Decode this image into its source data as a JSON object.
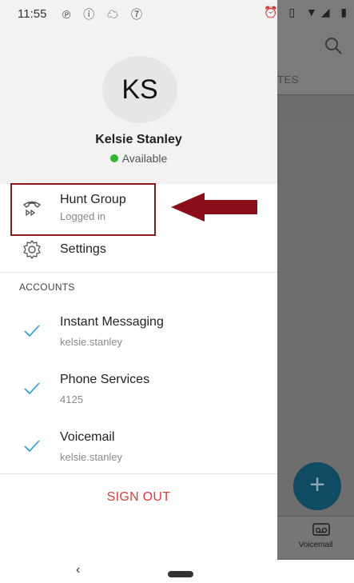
{
  "status_bar": {
    "time": "11:55",
    "left_icons": "℗ ⓘ ☁ ⑦",
    "right_icons": "⏰ ▯ ▼◢ ▮"
  },
  "background_app": {
    "tab_label": "TES",
    "bottom_nav_label": "Voicemail",
    "fab_symbol": "+"
  },
  "profile": {
    "initials": "KS",
    "name": "Kelsie Stanley",
    "presence": "Available",
    "presence_color": "#2fb82f"
  },
  "menu": {
    "hunt_group": {
      "label": "Hunt Group",
      "status": "Logged in"
    },
    "settings": {
      "label": "Settings"
    }
  },
  "accounts": {
    "title": "ACCOUNTS",
    "items": [
      {
        "name": "Instant Messaging",
        "detail": "kelsie.stanley"
      },
      {
        "name": "Phone Services",
        "detail": "4125"
      },
      {
        "name": "Voicemail",
        "detail": "kelsie.stanley"
      }
    ]
  },
  "sign_out": {
    "label": "SIGN OUT",
    "color": "#e53935"
  },
  "nav_bar": {
    "back": "‹"
  },
  "annotation": {
    "highlight_color": "#8b1a1a"
  }
}
